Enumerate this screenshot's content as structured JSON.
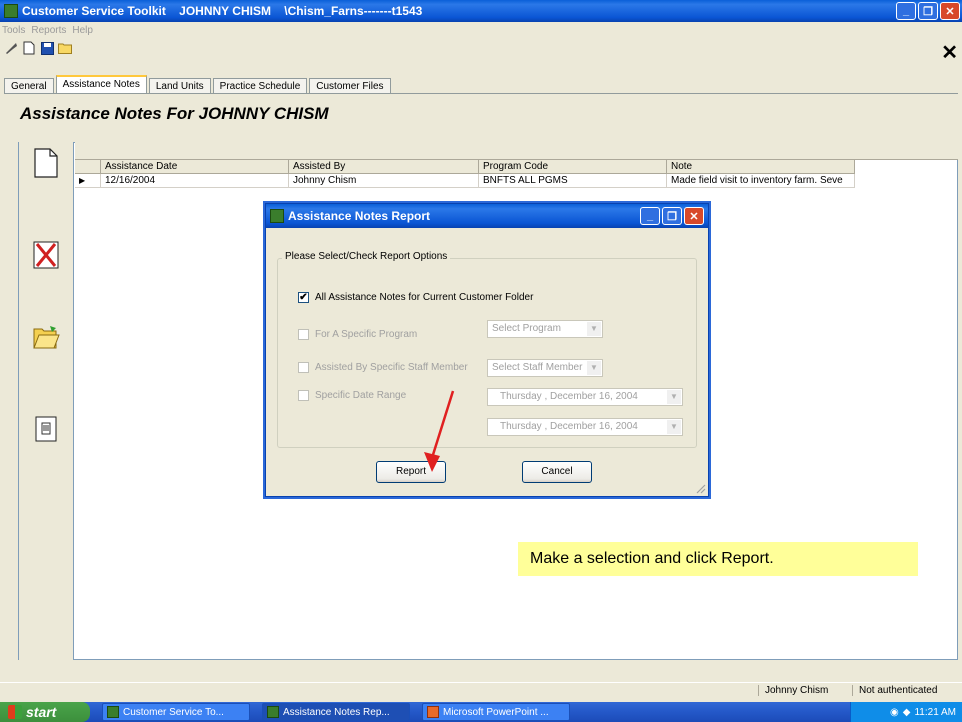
{
  "window": {
    "title": "Customer Service Toolkit    JOHNNY CHISM    \\Chism_Farns-------t1543",
    "min_label": "_",
    "max_label": "❐",
    "close_label": "✕"
  },
  "menu": [
    "Tools",
    "Reports",
    "Help"
  ],
  "toolbar": {
    "close_label": "✕"
  },
  "tabs": [
    "General",
    "Assistance Notes",
    "Land Units",
    "Practice Schedule",
    "Customer Files"
  ],
  "page": {
    "heading": "Assistance Notes For   JOHNNY CHISM"
  },
  "grid": {
    "columns": [
      "Assistance Date",
      "Assisted By",
      "Program Code",
      "Note"
    ],
    "rows": [
      {
        "indicator": "▶",
        "date": "12/16/2004",
        "by": "Johnny Chism",
        "program": "BNFTS ALL PGMS",
        "note": "Made field visit to inventory farm. Seve"
      }
    ]
  },
  "dialog": {
    "title": "Assistance Notes Report",
    "group_label": "Please Select/Check Report Options",
    "all_notes": {
      "label": "All Assistance Notes for Current Customer Folder",
      "checked": "✔"
    },
    "specific_program": {
      "label": "For A Specific Program",
      "combo": "Select Program"
    },
    "specific_staff": {
      "label": "Assisted By Specific Staff Member",
      "combo": "Select Staff Member"
    },
    "date_range": {
      "label": "Specific Date Range",
      "from": "Thursday  , December 16, 2004",
      "to": "Thursday  , December 16, 2004"
    },
    "report_button": "Report",
    "cancel_button": "Cancel"
  },
  "hint": "Make a selection and click Report.",
  "status": {
    "user": "Johnny Chism",
    "auth": "Not authenticated"
  },
  "taskbar": {
    "start": "start",
    "tasks": [
      "Customer Service To...",
      "Assistance Notes Rep...",
      "Microsoft PowerPoint ..."
    ],
    "clock": "11:21 AM"
  },
  "colors": {
    "hint_bg": "#ffff99",
    "arrow": "#e02020",
    "titlebar": "#0a55d4"
  }
}
